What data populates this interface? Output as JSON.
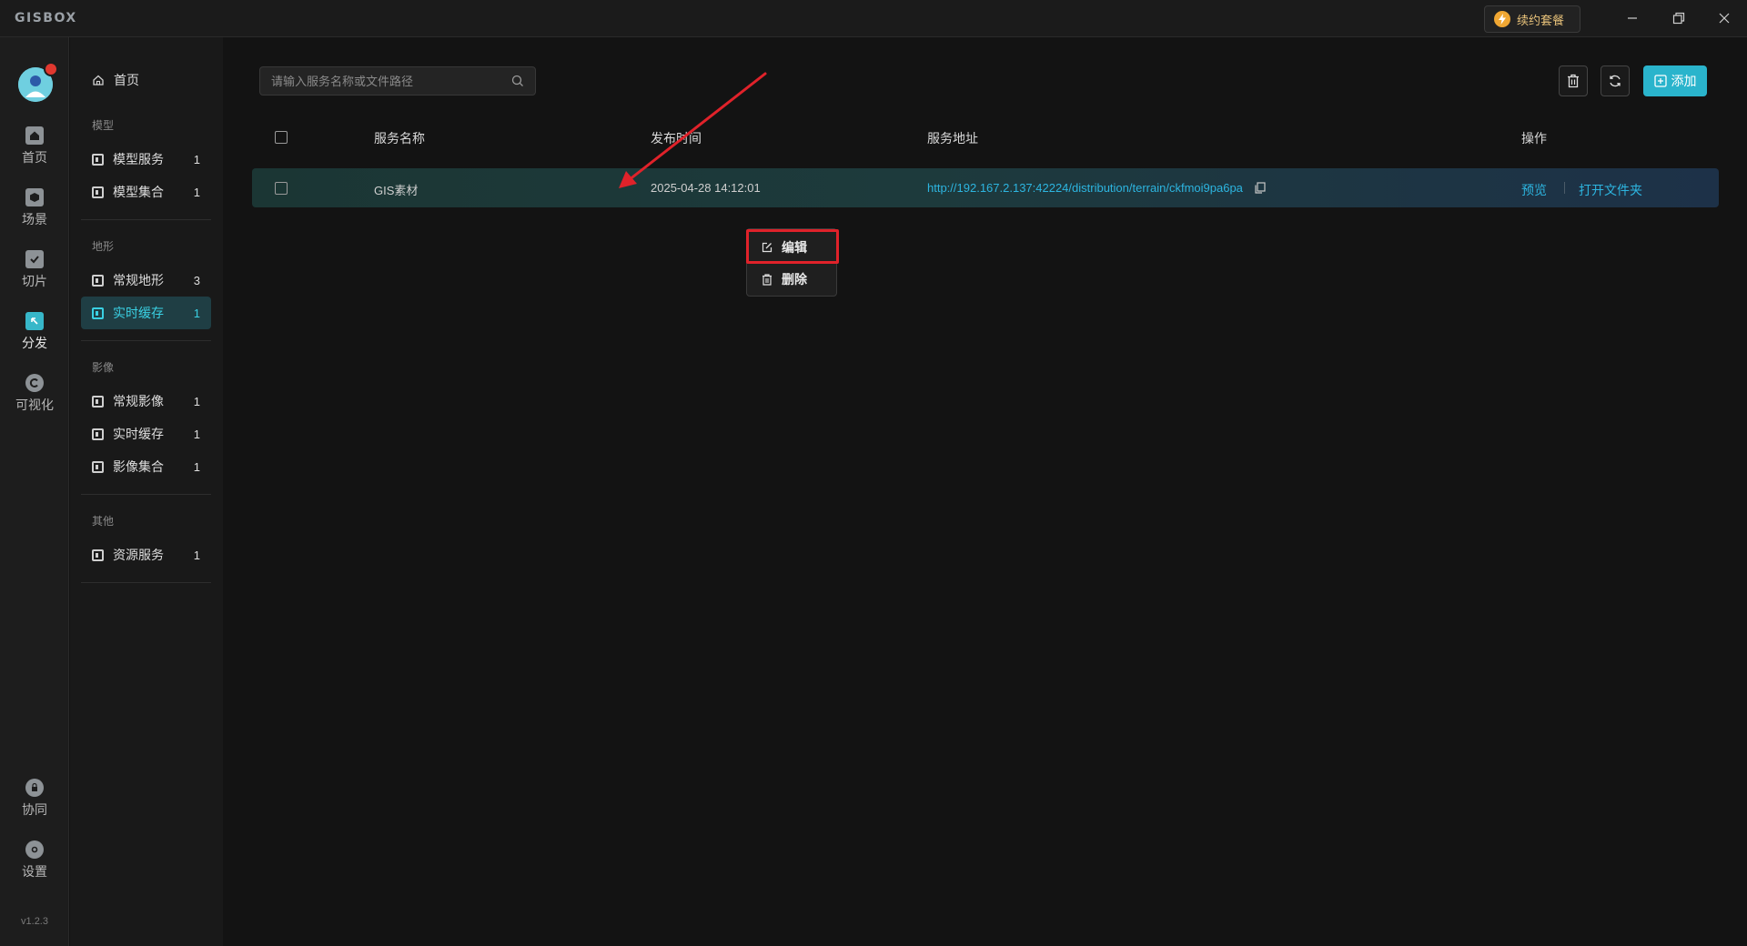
{
  "app": {
    "logo": "GISBOX"
  },
  "titlebar": {
    "renew_label": "续约套餐"
  },
  "rail": {
    "items": [
      {
        "label": "首页",
        "icon": "home-icon"
      },
      {
        "label": "场景",
        "icon": "scene-icon"
      },
      {
        "label": "切片",
        "icon": "tile-icon"
      },
      {
        "label": "分发",
        "icon": "distribute-icon",
        "active": true
      },
      {
        "label": "可视化",
        "icon": "visualize-icon"
      }
    ],
    "bottom_items": [
      {
        "label": "协同",
        "icon": "collab-icon"
      },
      {
        "label": "设置",
        "icon": "settings-icon"
      }
    ],
    "version": "v1.2.3"
  },
  "sidebar": {
    "home_label": "首页",
    "sections": [
      {
        "title": "模型",
        "items": [
          {
            "label": "模型服务",
            "count": "1"
          },
          {
            "label": "模型集合",
            "count": "1"
          }
        ]
      },
      {
        "title": "地形",
        "items": [
          {
            "label": "常规地形",
            "count": "3"
          },
          {
            "label": "实时缓存",
            "count": "1",
            "active": true
          }
        ]
      },
      {
        "title": "影像",
        "items": [
          {
            "label": "常规影像",
            "count": "1"
          },
          {
            "label": "实时缓存",
            "count": "1"
          },
          {
            "label": "影像集合",
            "count": "1"
          }
        ]
      },
      {
        "title": "其他",
        "items": [
          {
            "label": "资源服务",
            "count": "1"
          }
        ]
      }
    ]
  },
  "search": {
    "placeholder": "请输入服务名称或文件路径"
  },
  "toolbar": {
    "add_label": "添加"
  },
  "table": {
    "headers": {
      "name": "服务名称",
      "time": "发布时间",
      "address": "服务地址",
      "actions": "操作"
    },
    "rows": [
      {
        "name": "GIS素材",
        "time": "2025-04-28 14:12:01",
        "address": "http://192.167.2.137:42224/distribution/terrain/ckfmoi9pa6pa",
        "preview_label": "预览",
        "open_folder_label": "打开文件夹"
      }
    ]
  },
  "context_menu": {
    "edit_label": "编辑",
    "delete_label": "删除"
  },
  "colors": {
    "accent": "#2ab4cc",
    "link": "#2db5e0",
    "highlight": "#e0222a",
    "background": "#131313"
  }
}
